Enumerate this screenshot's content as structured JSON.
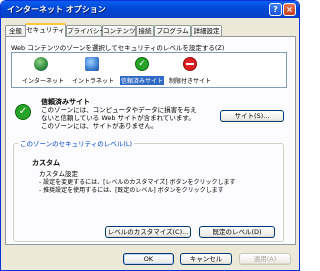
{
  "window": {
    "title": "インターネット オプション",
    "help_button": "?",
    "close_button": "×"
  },
  "tabs": [
    {
      "label": "全般",
      "active": false
    },
    {
      "label": "セキュリティ",
      "active": true
    },
    {
      "label": "プライバシー",
      "active": false
    },
    {
      "label": "コンテンツ",
      "active": false
    },
    {
      "label": "接続",
      "active": false
    },
    {
      "label": "プログラム",
      "active": false
    },
    {
      "label": "詳細設定",
      "active": false
    }
  ],
  "zones_section": {
    "intro": "Web コンテンツのゾーンを選択してセキュリティのレベルを設定する(Z)",
    "zones": [
      {
        "label": "インターネット",
        "icon": "globe-icon",
        "selected": false
      },
      {
        "label": "イントラネット",
        "icon": "intranet-icon",
        "selected": false
      },
      {
        "label": "信頼済みサイト",
        "icon": "check-icon",
        "selected": true
      },
      {
        "label": "制限付きサイト",
        "icon": "restricted-icon",
        "selected": false
      }
    ]
  },
  "selected_zone": {
    "name": "信頼済みサイト",
    "description_1": "このゾーンには、コンピュータやデータに損害を与えないと信頼している Web サイトが含まれています。",
    "description_2": "このゾーンには、サイトがありません。",
    "sites_button": "サイト(S)..."
  },
  "security_level": {
    "group_label": "このゾーンのセキュリティのレベル(L)",
    "title": "カスタム",
    "subtitle": "カスタム設定",
    "line_1": "- 設定を変更するには、[レベルのカスタマイズ] ボタンをクリックします",
    "line_2": "- 推奨設定を使用するには、[既定のレベル] ボタンをクリックします",
    "customize_button": "レベルのカスタマイズ(C)...",
    "default_level_button": "既定のレベル(D)"
  },
  "footer": {
    "ok_button": "OK",
    "cancel_button": "キャンセル",
    "apply_button": "適用(A)"
  },
  "colors": {
    "titlebar": "#0a5ff2",
    "selected_zone": "#316ac5",
    "group_label": "#0046d5",
    "active_tab_accent": "#ffc83c"
  }
}
